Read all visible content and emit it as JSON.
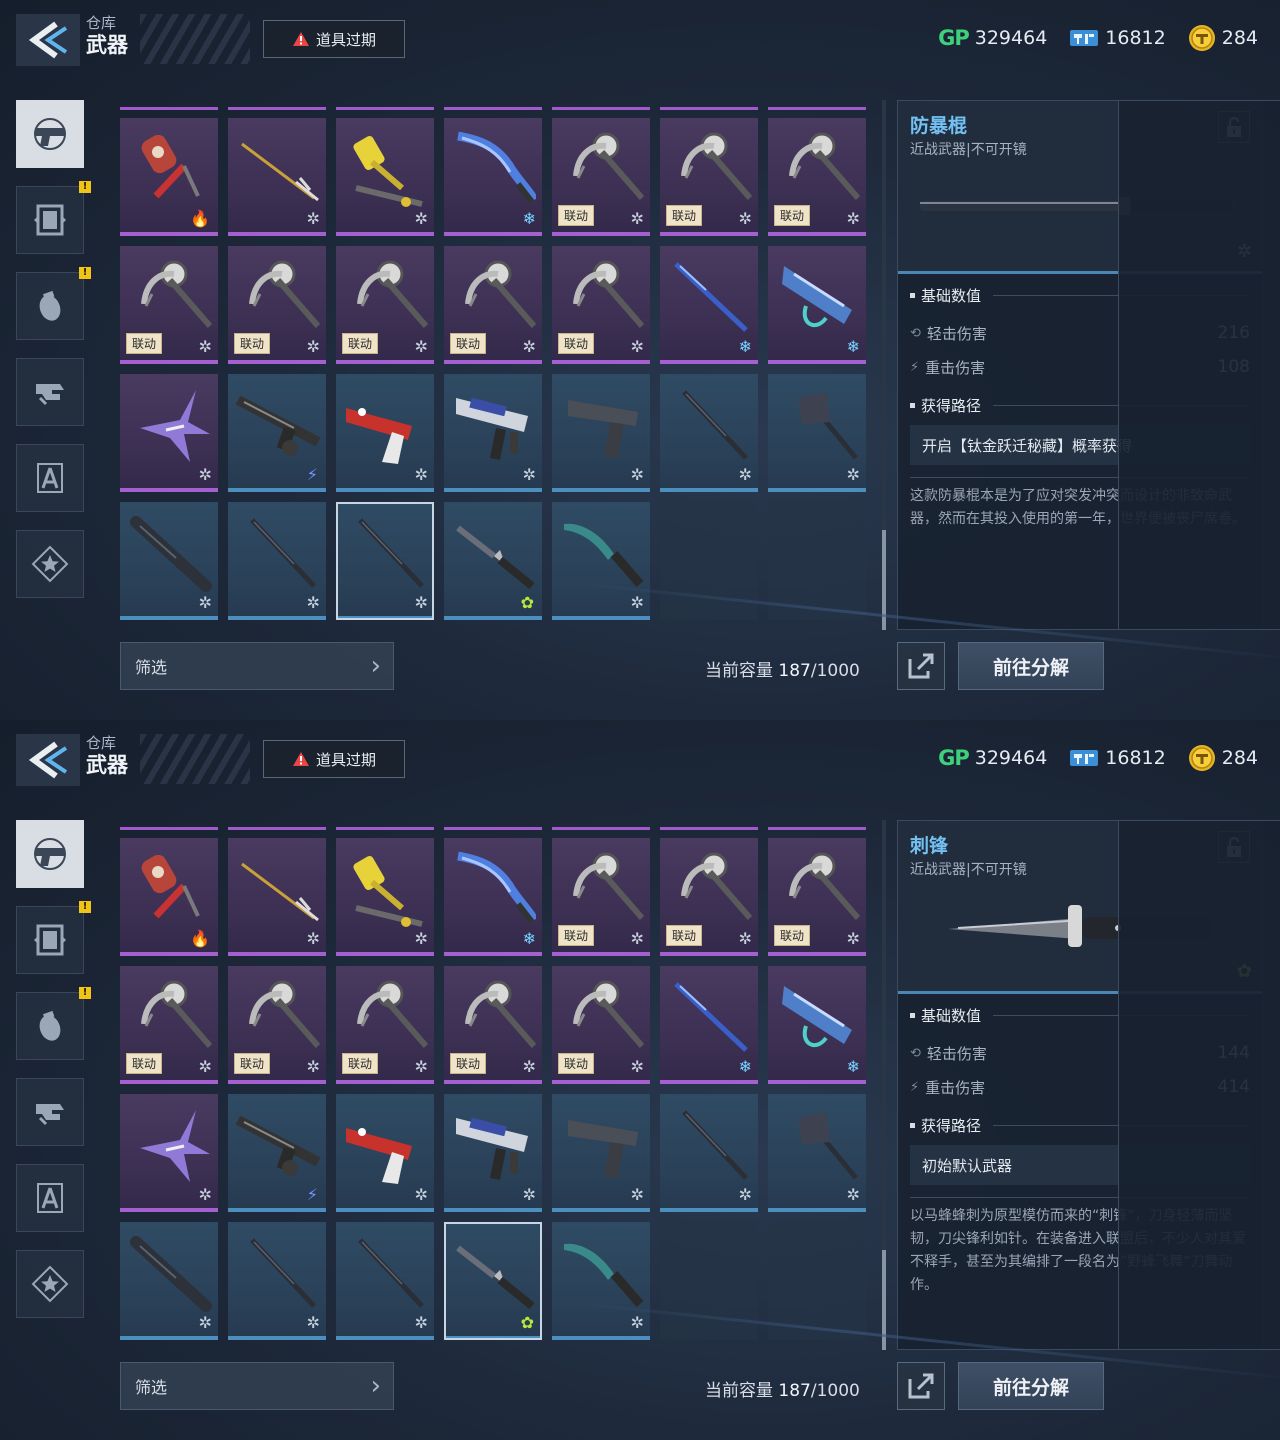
{
  "screens": [
    {
      "header": {
        "sub_title": "仓库",
        "title": "武器",
        "expire_button": "道具过期"
      },
      "currencies": {
        "gp_label": "GP",
        "gp": "329464",
        "ticket": "16812",
        "coin": "284"
      },
      "nav": {
        "items": [
          "weapon-pistol-icon",
          "frame-icon",
          "grenade-icon",
          "armor-icon",
          "tools-icon",
          "star-badge-icon"
        ],
        "badges": [
          false,
          true,
          true,
          false,
          false,
          false
        ]
      },
      "grid": {
        "rows": [
          [
            {
              "rarity": "purple",
              "art": "hammer-red",
              "mark": "fire"
            },
            {
              "rarity": "purple",
              "art": "spear-gold",
              "mark": "snow"
            },
            {
              "rarity": "purple",
              "art": "gold-hammer",
              "mark": "snow"
            },
            {
              "rarity": "purple",
              "art": "blue-blade",
              "mark": "snow-blue"
            },
            {
              "rarity": "purple",
              "art": "scythe",
              "mark": "snow",
              "tag": "联动"
            },
            {
              "rarity": "purple",
              "art": "scythe",
              "mark": "snow",
              "tag": "联动"
            },
            {
              "rarity": "purple",
              "art": "scythe",
              "mark": "snow",
              "tag": "联动"
            }
          ],
          [
            {
              "rarity": "purple",
              "art": "scythe",
              "mark": "snow",
              "tag": "联动"
            },
            {
              "rarity": "purple",
              "art": "scythe",
              "mark": "snow",
              "tag": "联动"
            },
            {
              "rarity": "purple",
              "art": "scythe",
              "mark": "snow",
              "tag": "联动"
            },
            {
              "rarity": "purple",
              "art": "scythe",
              "mark": "snow",
              "tag": "联动"
            },
            {
              "rarity": "purple",
              "art": "scythe",
              "mark": "snow",
              "tag": "联动"
            },
            {
              "rarity": "purple",
              "art": "blue-spear",
              "mark": "snow-blue"
            },
            {
              "rarity": "purple",
              "art": "blue-gun",
              "mark": "snow-blue"
            }
          ],
          [
            {
              "rarity": "purple",
              "art": "purple-claw",
              "mark": "snow"
            },
            {
              "rarity": "blue",
              "art": "rifle",
              "mark": "bolt"
            },
            {
              "rarity": "blue",
              "art": "red-pistol",
              "mark": "snow"
            },
            {
              "rarity": "blue",
              "art": "smg",
              "mark": "snow"
            },
            {
              "rarity": "blue",
              "art": "pistol",
              "mark": "snow"
            },
            {
              "rarity": "blue",
              "art": "stick",
              "mark": "snow"
            },
            {
              "rarity": "blue",
              "art": "axe",
              "mark": "snow"
            }
          ],
          [
            {
              "rarity": "blue",
              "art": "bat",
              "mark": "snow"
            },
            {
              "rarity": "blue",
              "art": "stick",
              "mark": "snow"
            },
            {
              "rarity": "blue",
              "art": "stick",
              "mark": "snow",
              "selected": true
            },
            {
              "rarity": "blue",
              "art": "knife",
              "mark": "green"
            },
            {
              "rarity": "blue",
              "art": "machete",
              "mark": "snow"
            },
            {
              "rarity": "empty"
            },
            {
              "rarity": "empty"
            }
          ]
        ]
      },
      "filter_label": "筛选",
      "capacity": {
        "label": "当前容量",
        "current": "187",
        "max": "/1000"
      },
      "buttons": {
        "decompose": "前往分解",
        "detail": "详情"
      },
      "detail": {
        "name": "防暴棍",
        "type": "近战武器|不可开镜",
        "art": "baton",
        "rarity_mark": "snow",
        "stats_header": "基础数值",
        "stats": [
          {
            "label": "轻击伤害",
            "value": "216"
          },
          {
            "label": "重击伤害",
            "value": "108"
          }
        ],
        "source_header": "获得路径",
        "source": "开启【钛金跃迁秘藏】概率获得",
        "description": "这款防暴棍本是为了应对突发冲突而设计的非致命武器，然而在其投入使用的第一年，世界便被丧尸席卷。"
      }
    },
    {
      "header": {
        "sub_title": "仓库",
        "title": "武器",
        "expire_button": "道具过期"
      },
      "currencies": {
        "gp_label": "GP",
        "gp": "329464",
        "ticket": "16812",
        "coin": "284"
      },
      "nav": {
        "items": [
          "weapon-pistol-icon",
          "frame-icon",
          "grenade-icon",
          "armor-icon",
          "tools-icon",
          "star-badge-icon"
        ],
        "badges": [
          false,
          true,
          true,
          false,
          false,
          false
        ]
      },
      "grid": {
        "rows": [
          [
            {
              "rarity": "purple",
              "art": "hammer-red",
              "mark": "fire"
            },
            {
              "rarity": "purple",
              "art": "spear-gold",
              "mark": "snow"
            },
            {
              "rarity": "purple",
              "art": "gold-hammer",
              "mark": "snow"
            },
            {
              "rarity": "purple",
              "art": "blue-blade",
              "mark": "snow-blue"
            },
            {
              "rarity": "purple",
              "art": "scythe",
              "mark": "snow",
              "tag": "联动"
            },
            {
              "rarity": "purple",
              "art": "scythe",
              "mark": "snow",
              "tag": "联动"
            },
            {
              "rarity": "purple",
              "art": "scythe",
              "mark": "snow",
              "tag": "联动"
            }
          ],
          [
            {
              "rarity": "purple",
              "art": "scythe",
              "mark": "snow",
              "tag": "联动"
            },
            {
              "rarity": "purple",
              "art": "scythe",
              "mark": "snow",
              "tag": "联动"
            },
            {
              "rarity": "purple",
              "art": "scythe",
              "mark": "snow",
              "tag": "联动"
            },
            {
              "rarity": "purple",
              "art": "scythe",
              "mark": "snow",
              "tag": "联动"
            },
            {
              "rarity": "purple",
              "art": "scythe",
              "mark": "snow",
              "tag": "联动"
            },
            {
              "rarity": "purple",
              "art": "blue-spear",
              "mark": "snow-blue"
            },
            {
              "rarity": "purple",
              "art": "blue-gun",
              "mark": "snow-blue"
            }
          ],
          [
            {
              "rarity": "purple",
              "art": "purple-claw",
              "mark": "snow"
            },
            {
              "rarity": "blue",
              "art": "rifle",
              "mark": "bolt"
            },
            {
              "rarity": "blue",
              "art": "red-pistol",
              "mark": "snow"
            },
            {
              "rarity": "blue",
              "art": "smg",
              "mark": "snow"
            },
            {
              "rarity": "blue",
              "art": "pistol",
              "mark": "snow"
            },
            {
              "rarity": "blue",
              "art": "stick",
              "mark": "snow"
            },
            {
              "rarity": "blue",
              "art": "axe",
              "mark": "snow"
            }
          ],
          [
            {
              "rarity": "blue",
              "art": "bat",
              "mark": "snow"
            },
            {
              "rarity": "blue",
              "art": "stick",
              "mark": "snow"
            },
            {
              "rarity": "blue",
              "art": "stick",
              "mark": "snow"
            },
            {
              "rarity": "blue",
              "art": "knife",
              "mark": "green",
              "selected": true
            },
            {
              "rarity": "blue",
              "art": "machete",
              "mark": "snow"
            },
            {
              "rarity": "empty"
            },
            {
              "rarity": "empty"
            }
          ]
        ]
      },
      "filter_label": "筛选",
      "capacity": {
        "label": "当前容量",
        "current": "187",
        "max": "/1000"
      },
      "buttons": {
        "decompose": "前往分解",
        "detail": "详情"
      },
      "detail": {
        "name": "刺锋",
        "type": "近战武器|不可开镜",
        "art": "knife",
        "rarity_mark": "green",
        "stats_header": "基础数值",
        "stats": [
          {
            "label": "轻击伤害",
            "value": "144"
          },
          {
            "label": "重击伤害",
            "value": "414"
          }
        ],
        "source_header": "获得路径",
        "source": "初始默认武器",
        "description": "以马蜂蜂刺为原型模仿而来的“刺锋”，刀身轻薄而坚韧，刀尖锋利如针。在装备进入联盟后，不少人对其爱不释手，甚至为其编排了一段名为”野蜂飞舞“刀舞动作。"
      }
    }
  ]
}
